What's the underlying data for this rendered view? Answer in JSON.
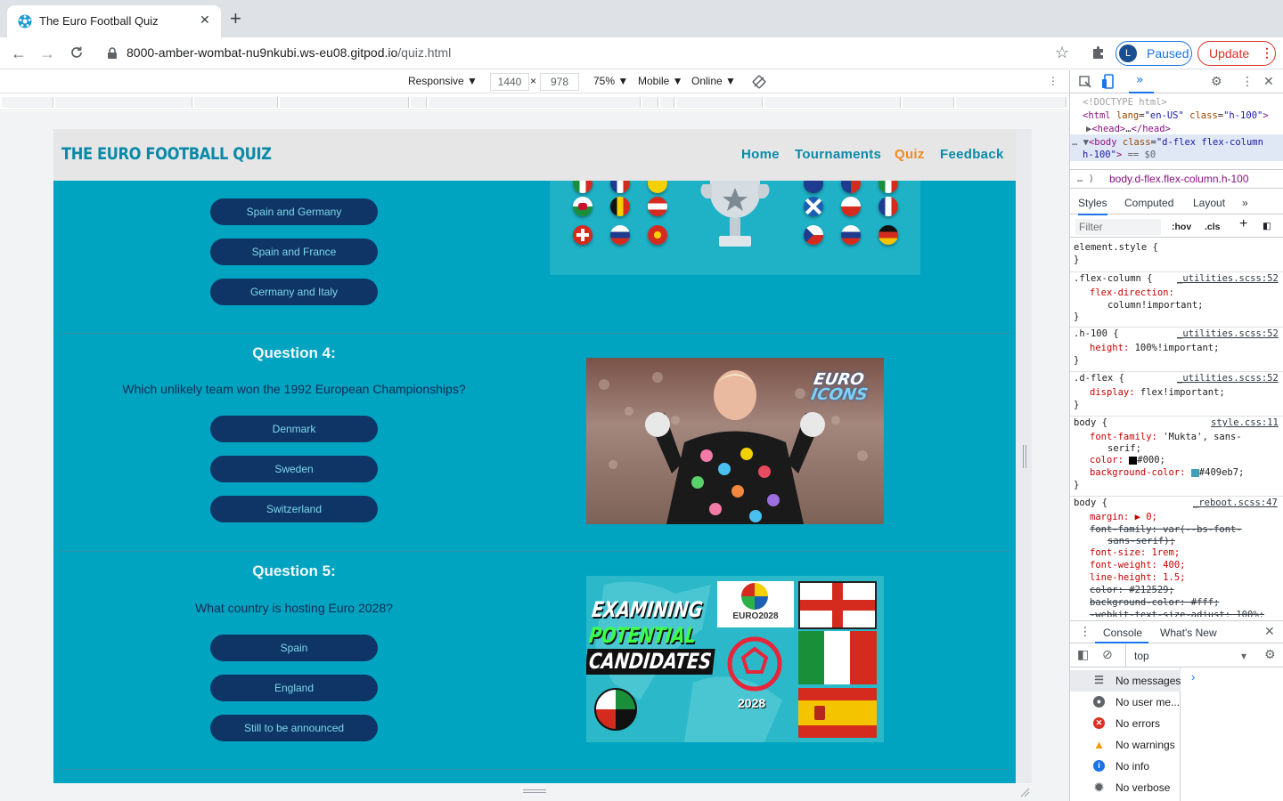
{
  "browser": {
    "tab_title": "The Euro Football Quiz",
    "tab_close": "✕",
    "new_tab": "+",
    "url_host": "8000-amber-wombat-nu9nkubi.ws-eu08.gitpod.io",
    "url_path": "/quiz.html",
    "profile_initial": "L",
    "profile_label": "Paused",
    "update_label": "Update"
  },
  "device_toolbar": {
    "mode": "Responsive ▼",
    "width": "1440",
    "times": "×",
    "height": "978",
    "zoom": "75% ▼",
    "device_type": "Mobile ▼",
    "throttle": "Online ▼"
  },
  "site": {
    "logo": "THE EURO FOOTBALL QUIZ",
    "nav": [
      "Home",
      "Tournaments",
      "Quiz",
      "Feedback"
    ],
    "active_nav": "Quiz",
    "q3_answers": [
      "Spain and Germany",
      "Spain and France",
      "Germany and Italy"
    ],
    "q4": {
      "heading": "Question 4:",
      "text": "Which unlikely team won the 1992 European Championships?",
      "answers": [
        "Denmark",
        "Sweden",
        "Switzerland"
      ],
      "image_badge": [
        "EURO",
        "ICONS"
      ]
    },
    "q5": {
      "heading": "Question 5:",
      "text": "What country is hosting Euro 2028?",
      "answers": [
        "Spain",
        "England",
        "Still to be announced"
      ],
      "image_lines": [
        "EXAMINING",
        "POTENTIAL",
        "CANDIDATES"
      ],
      "image_logo": "EURO2028",
      "image_year": "2028"
    }
  },
  "devtools": {
    "doctype": "<!DOCTYPE html>",
    "breadcrumb": "body.d-flex.flex-column.h-100",
    "pane_tabs": [
      "Styles",
      "Computed",
      "Layout"
    ],
    "filter_placeholder": "Filter",
    "hov": ":hov",
    "cls": ".cls",
    "rules": {
      "element_style": "element.style {",
      "flex_column_sel": ".flex-column {",
      "flex_column_file": "_utilities.scss:52",
      "flex_column_prop": "flex-direction:",
      "flex_column_val": "column!important;",
      "h100_sel": ".h-100 {",
      "h100_file": "_utilities.scss:52",
      "h100_prop": "height:",
      "h100_val": "100%!important;",
      "dflex_sel": ".d-flex {",
      "dflex_file": "_utilities.scss:52",
      "dflex_prop": "display:",
      "dflex_val": "flex!important;",
      "body_sel": "body {",
      "body_file": "style.css:11",
      "body_ff_prop": "font-family:",
      "body_ff_val": "'Mukta', sans-",
      "body_ff_val2": "serif;",
      "body_color_prop": "color:",
      "body_color_val": "#000;",
      "body_bg_prop": "background-color:",
      "body_bg_val": "#409eb7;",
      "reboot_sel": "body {",
      "reboot_file": "_reboot.scss:47",
      "reboot_margin": "margin: ▶ 0;",
      "reboot_ff": "font-family: var(--bs-font-",
      "reboot_ff2": "sans-serif);",
      "reboot_fs": "font-size: 1rem;",
      "reboot_fw": "font-weight: 400;",
      "reboot_lh": "line-height: 1.5;",
      "reboot_color": "color: #212529;",
      "reboot_bg": "background-color: #fff;",
      "reboot_wk": "-webkit-text-size-adjust: 100%;"
    },
    "console_tabs": [
      "Console",
      "What's New"
    ],
    "context": "top",
    "messages": [
      "No messages",
      "No user me...",
      "No errors",
      "No warnings",
      "No info",
      "No verbose"
    ],
    "colors": {
      "body_color": "#000000",
      "body_bg": "#409eb7",
      "site_bg": "#00a3c0",
      "button_bg": "#0e3566",
      "accent": "#f08a24"
    }
  }
}
